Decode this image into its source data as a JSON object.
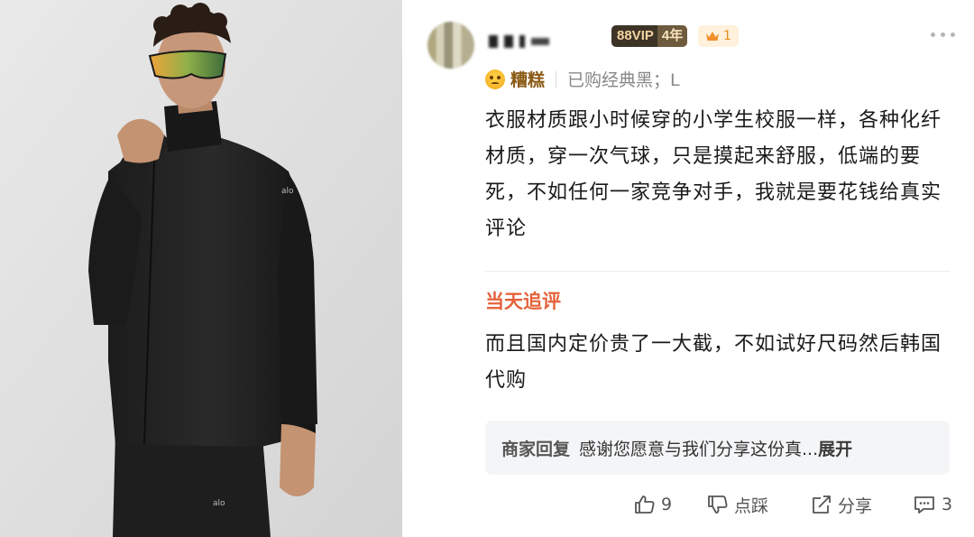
{
  "header": {
    "vip_badge": "88VIP",
    "years_badge": "4年",
    "level_count": "1",
    "icons": [
      "crown-icon",
      "more-icon"
    ]
  },
  "review": {
    "rating_label": "糟糕",
    "purchased_spec": "已购经典黑；L",
    "body": "衣服材质跟小时候穿的小学生校服一样，各种化纤材质，穿一次气球，只是摸起来舒服，低端的要死，不如任何一家竞争对手，我就是要花钱给真实评论",
    "followup_label": "当天追评",
    "followup_body": "而且国内定价贵了一大截，不如试好尺码然后韩国代购"
  },
  "merchant_reply": {
    "label": "商家回复",
    "text": "感谢您愿意与我们分享这份真...",
    "expand": "展开"
  },
  "actions": {
    "like_count": "9",
    "dislike_label": "点踩",
    "share_label": "分享",
    "comment_count": "3"
  },
  "colors": {
    "accent": "#e5623a",
    "vip_bg": "#3d3327",
    "vip_text": "#f4d5a1",
    "reply_bg": "#f4f5f7"
  }
}
